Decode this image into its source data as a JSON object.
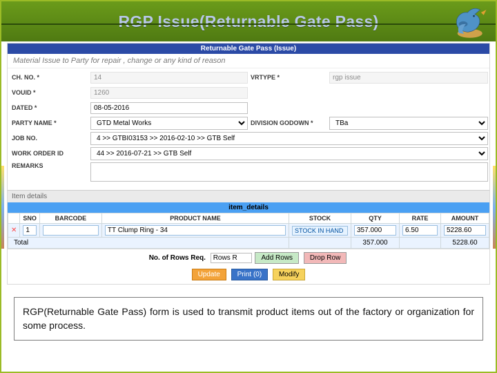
{
  "header": {
    "title": "RGP Issue(Returnable Gate Pass)"
  },
  "formbar": {
    "title": "Returnable Gate Pass (Issue)"
  },
  "subhead": "Material Issue to Party for repair , change or any kind of reason",
  "labels": {
    "chno": "CH. NO. *",
    "vrtype": "VRTYPE *",
    "vouid": "VOUID *",
    "dated": "DATED *",
    "party": "PARTY NAME *",
    "division": "DIVISION GODOWN *",
    "jobno": "JOB NO.",
    "workorder": "WORK ORDER ID",
    "remarks": "REMARKS"
  },
  "values": {
    "chno": "14",
    "vrtype": "rgp issue",
    "vouid": "1260",
    "dated": "08-05-2016",
    "party": "GTD Metal Works",
    "division": "TBa",
    "jobno": "4 >> GTBI03153 >> 2016-02-10 >> GTB Self",
    "workorder": "44 >> 2016-07-21 >> GTB Self",
    "remarks": ""
  },
  "itemdetails": {
    "tab": "Item details",
    "bar": "item_details",
    "cols": [
      "",
      "SNO",
      "BARCODE",
      "PRODUCT NAME",
      "STOCK",
      "QTY",
      "RATE",
      "AMOUNT"
    ],
    "row": {
      "sno": "1",
      "barcode": "",
      "product": "TT Clump Ring - 34",
      "stock": "STOCK IN HAND",
      "qty": "357.000",
      "rate": "6.50",
      "amount": "5228.60"
    },
    "total": {
      "label": "Total",
      "qty": "357.000",
      "amount": "5228.60"
    }
  },
  "controls": {
    "rows_label": "No. of Rows Req.",
    "rows_value": "Rows R",
    "add_rows": "Add Rows",
    "drop_row": "Drop Row",
    "update": "Update",
    "print": "Print (0)",
    "modify": "Modify"
  },
  "caption": "RGP(Returnable Gate Pass) form is used to transmit product items out of the factory or organization for some process."
}
